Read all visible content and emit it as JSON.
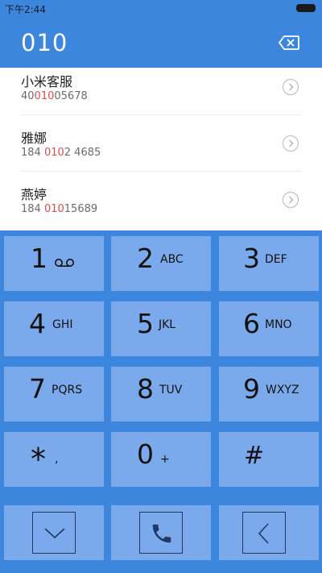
{
  "status_bar": {
    "time": "下午2:44"
  },
  "dialer": {
    "number": "010"
  },
  "contacts": [
    {
      "name": "小米客服",
      "number_parts": [
        "40",
        "010",
        "05678"
      ]
    },
    {
      "name": "雅娜",
      "number_parts": [
        "184 ",
        "010",
        "2 4685"
      ]
    },
    {
      "name": "燕婷",
      "number_parts": [
        "184 ",
        "010",
        "15689"
      ]
    }
  ],
  "keypad": [
    {
      "digit": "1",
      "letters": ""
    },
    {
      "digit": "2",
      "letters": "ABC"
    },
    {
      "digit": "3",
      "letters": "DEF"
    },
    {
      "digit": "4",
      "letters": "GHI"
    },
    {
      "digit": "5",
      "letters": "JKL"
    },
    {
      "digit": "6",
      "letters": "MNO"
    },
    {
      "digit": "7",
      "letters": "PQRS"
    },
    {
      "digit": "8",
      "letters": "TUV"
    },
    {
      "digit": "9",
      "letters": "WXYZ"
    },
    {
      "digit": "*",
      "letters": ","
    },
    {
      "digit": "0",
      "letters": "+"
    },
    {
      "digit": "#",
      "letters": ""
    }
  ],
  "icons": {
    "voicemail": "voicemail-icon",
    "collapse": "chevron-down-icon",
    "call": "phone-icon",
    "back": "chevron-left-icon",
    "delete": "backspace-icon"
  },
  "colors": {
    "accent": "#3d86dd",
    "key": "#7aaaeb",
    "highlight": "#e24848"
  }
}
